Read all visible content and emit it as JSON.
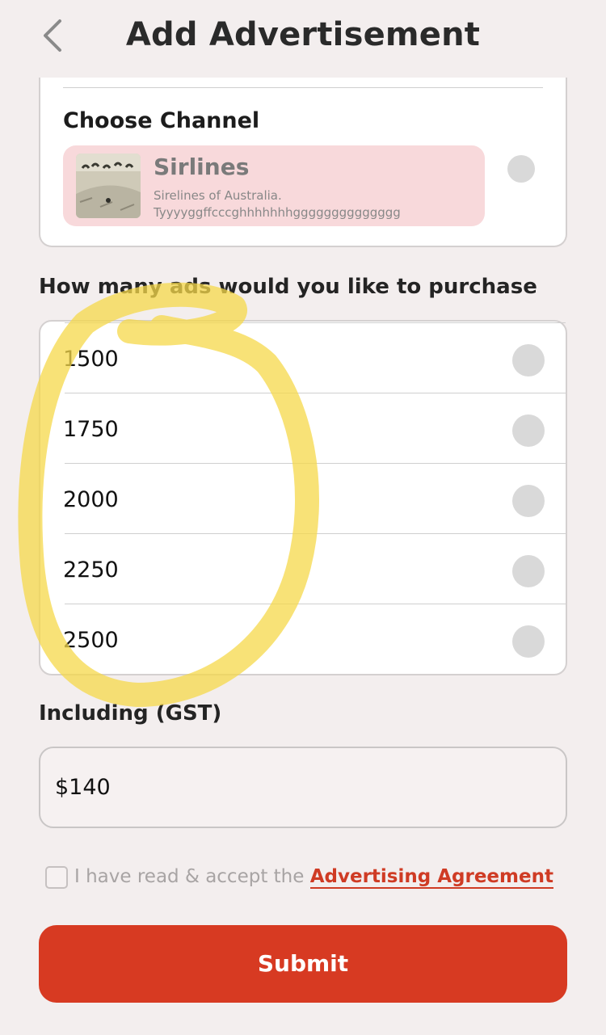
{
  "header": {
    "title": "Add Advertisement",
    "back_icon": "chevron-left-icon"
  },
  "channel_section": {
    "title": "Choose Channel",
    "channels": [
      {
        "name": "Sirlines",
        "description": "Sirelines of Australia. Tyyyyggffcccghhhhhhhgggggggggggggg",
        "selected": false
      }
    ]
  },
  "ads_section": {
    "label": "How many ads would you like to purchase",
    "options": [
      {
        "value": "1500",
        "selected": false
      },
      {
        "value": "1750",
        "selected": false
      },
      {
        "value": "2000",
        "selected": false
      },
      {
        "value": "2250",
        "selected": false
      },
      {
        "value": "2500",
        "selected": false
      }
    ]
  },
  "gst_section": {
    "label": "Including (GST)",
    "value": "$140"
  },
  "agreement": {
    "prefix": "I have read & accept the ",
    "link_label": "Advertising Agreement",
    "checked": false
  },
  "submit_label": "Submit",
  "colors": {
    "accent": "#d73a22",
    "background": "#f3eeee",
    "channel_highlight": "#f8d9db",
    "annotation": "#f5d84a"
  }
}
